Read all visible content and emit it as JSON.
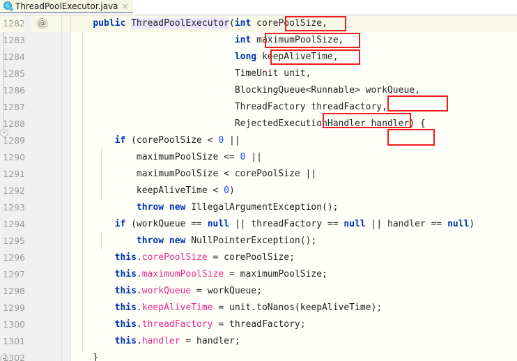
{
  "tab": {
    "icon": "java-class-icon",
    "filename": "ThreadPoolExecutor.java",
    "close": "×"
  },
  "gutter": {
    "annotation_glyph": "@",
    "fold_glyph": "fold-collapse-icon"
  },
  "editor": {
    "first_line_number": 1282,
    "lines": [
      {
        "num": "1282",
        "indent": 0
      },
      {
        "num": "1283",
        "indent": 0
      },
      {
        "num": "1284",
        "indent": 0
      },
      {
        "num": "1285",
        "indent": 0
      },
      {
        "num": "1286",
        "indent": 0
      },
      {
        "num": "1287",
        "indent": 0
      },
      {
        "num": "1288",
        "indent": 0
      },
      {
        "num": "1289",
        "indent": 0
      },
      {
        "num": "1290",
        "indent": 0
      },
      {
        "num": "1291",
        "indent": 0
      },
      {
        "num": "1292",
        "indent": 0
      },
      {
        "num": "1293",
        "indent": 0
      },
      {
        "num": "1294",
        "indent": 0
      },
      {
        "num": "1295",
        "indent": 0
      },
      {
        "num": "1296",
        "indent": 0
      },
      {
        "num": "1297",
        "indent": 0
      },
      {
        "num": "1298",
        "indent": 0
      },
      {
        "num": "1299",
        "indent": 0
      },
      {
        "num": "1300",
        "indent": 0
      },
      {
        "num": "1301",
        "indent": 0
      },
      {
        "num": "1302",
        "indent": 0
      }
    ],
    "code_text": {
      "l1282": "    public ThreadPoolExecutor(int corePoolSize,",
      "l1283": "                              int maximumPoolSize,",
      "l1284": "                              long keepAliveTime,",
      "l1285": "                              TimeUnit unit,",
      "l1286": "                              BlockingQueue<Runnable> workQueue,",
      "l1287": "                              ThreadFactory threadFactory,",
      "l1288": "                              RejectedExecutionHandler handler) {",
      "l1289": "        if (corePoolSize < 0 ||",
      "l1290": "            maximumPoolSize <= 0 ||",
      "l1291": "            maximumPoolSize < corePoolSize ||",
      "l1292": "            keepAliveTime < 0)",
      "l1293": "            throw new IllegalArgumentException();",
      "l1294": "        if (workQueue == null || threadFactory == null || handler == null)",
      "l1295": "            throw new NullPointerException();",
      "l1296": "        this.corePoolSize = corePoolSize;",
      "l1297": "        this.maximumPoolSize = maximumPoolSize;",
      "l1298": "        this.workQueue = workQueue;",
      "l1299": "        this.keepAliveTime = unit.toNanos(keepAliveTime);",
      "l1300": "        this.threadFactory = threadFactory;",
      "l1301": "        this.handler = handler;",
      "l1302": "    }"
    },
    "tokens": {
      "kw_public": "public",
      "cls_name": "ThreadPoolExecutor",
      "kw_int": "int",
      "kw_long": "long",
      "kw_if": "if",
      "kw_throw": "throw",
      "kw_new": "new",
      "kw_null": "null",
      "kw_this": "this",
      "num_zero": "0",
      "type_timeunit": "TimeUnit",
      "type_blockingqueue": "BlockingQueue<Runnable>",
      "type_threadfactory": "ThreadFactory",
      "type_rejectedhandler": "RejectedExecutionHandler",
      "exc_illegalargument": "IllegalArgumentException",
      "exc_nullpointer": "NullPointerException"
    },
    "highlighted_params": [
      "corePoolSize,",
      "maximumPoolSize,",
      "keepAliveTime,",
      "workQueue,",
      "threadFactory,",
      "handler"
    ],
    "colors": {
      "keyword": "#0033b3",
      "number": "#1750eb",
      "field": "#e8288c",
      "plain": "#222222",
      "annotation_box": "#f21a1a",
      "current_line_bg": "#f8f8e8",
      "editor_bg": "#fffffa",
      "gutter_bg": "#f0f0f0",
      "line_number": "#999999",
      "caret_identifier_bg": "#ece6ff"
    }
  }
}
